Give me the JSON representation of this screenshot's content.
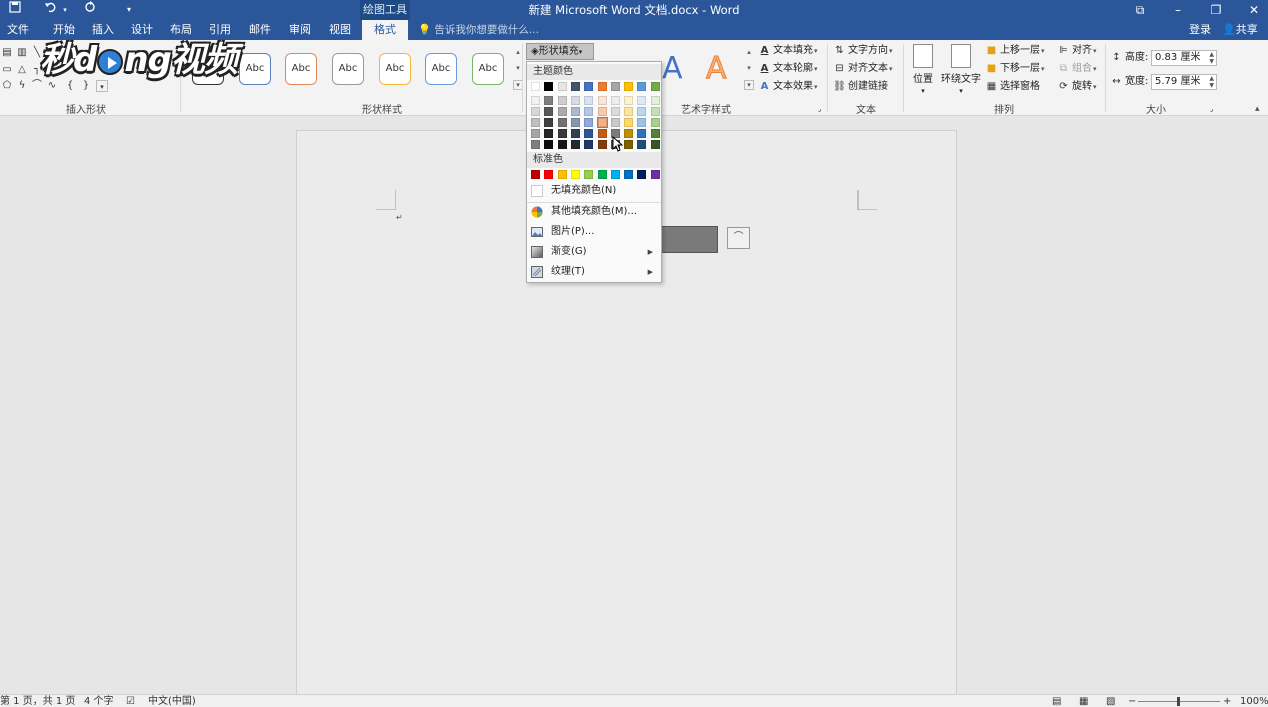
{
  "titlebar": {
    "title": "新建 Microsoft Word 文档.docx - Word",
    "context_tab": "绘图工具",
    "save_icon": "save-icon",
    "undo_icon": "undo-icon",
    "redo_icon": "repeat-icon"
  },
  "tabs": [
    {
      "label": "文件"
    },
    {
      "label": "开始"
    },
    {
      "label": "插入"
    },
    {
      "label": "设计"
    },
    {
      "label": "布局"
    },
    {
      "label": "引用"
    },
    {
      "label": "邮件"
    },
    {
      "label": "审阅"
    },
    {
      "label": "视图"
    },
    {
      "label": "格式"
    }
  ],
  "tellme": "告诉我你想要做什么...",
  "account": {
    "signin": "登录",
    "share": "共享"
  },
  "ribbon": {
    "groups": {
      "insert_shapes": "插入形状",
      "shape_styles": "形状样式",
      "wordart_styles": "艺术字样式",
      "text": "文本",
      "arrange": "排列",
      "size": "大小"
    },
    "style_label": "Abc",
    "shape_fill": "形状填充",
    "text_fill": "文本填充",
    "text_outline": "文本轮廓",
    "text_effects": "文本效果",
    "text_direction": "文字方向",
    "align_text": "对齐文本",
    "create_link": "创建链接",
    "position": "位置",
    "wrap_text": "环绕文字",
    "bring_forward": "上移一层",
    "send_backward": "下移一层",
    "selection_pane": "选择窗格",
    "align": "对齐",
    "group": "组合",
    "rotate": "旋转",
    "height_label": "高度:",
    "height_value": "0.83 厘米",
    "width_label": "宽度:",
    "width_value": "5.79 厘米",
    "wordart_letter": "A"
  },
  "dropdown": {
    "theme_colors_header": "主题颜色",
    "standard_colors_header": "标准色",
    "no_fill": "无填充颜色(N)",
    "more_colors": "其他填充颜色(M)...",
    "picture": "图片(P)...",
    "gradient": "渐变(G)",
    "texture": "纹理(T)",
    "theme_top": [
      "#ffffff",
      "#000000",
      "#e7e6e6",
      "#44546a",
      "#4472c4",
      "#ed7d31",
      "#a5a5a5",
      "#ffc000",
      "#5b9bd5",
      "#70ad47"
    ],
    "theme_tints": [
      [
        "#f2f2f2",
        "#7f7f7f",
        "#d0cece",
        "#d6dce4",
        "#d9e2f3",
        "#fbe5d5",
        "#ededed",
        "#fff2cc",
        "#deebf6",
        "#e2efd9"
      ],
      [
        "#d8d8d8",
        "#595959",
        "#aeabab",
        "#adb9ca",
        "#b4c6e7",
        "#f7caac",
        "#dbdbdb",
        "#fee599",
        "#bdd7ee",
        "#c5e0b3"
      ],
      [
        "#bfbfbf",
        "#3f3f3f",
        "#757070",
        "#8496b0",
        "#8eaadb",
        "#f4b183",
        "#c9c9c9",
        "#ffd965",
        "#9cc3e5",
        "#a8d08d"
      ],
      [
        "#a5a5a5",
        "#262626",
        "#3a3838",
        "#323f4f",
        "#2f5496",
        "#c55a11",
        "#7b7b7b",
        "#bf8f00",
        "#2e75b5",
        "#538135"
      ],
      [
        "#7f7f7f",
        "#0c0c0c",
        "#171616",
        "#222a35",
        "#1f3864",
        "#833c0b",
        "#525252",
        "#7f6000",
        "#1e4e79",
        "#375623"
      ]
    ],
    "standard": [
      "#c00000",
      "#ff0000",
      "#ffc000",
      "#ffff00",
      "#92d050",
      "#00b050",
      "#00b0f0",
      "#0070c0",
      "#002060",
      "#7030a0"
    ]
  },
  "watermark": {
    "left": "秒d",
    "right": "ng视频"
  },
  "statusbar": {
    "page": "第 1 页，共 1 页",
    "words": "4 个字",
    "language": "中文(中国)",
    "zoom": "100%"
  }
}
